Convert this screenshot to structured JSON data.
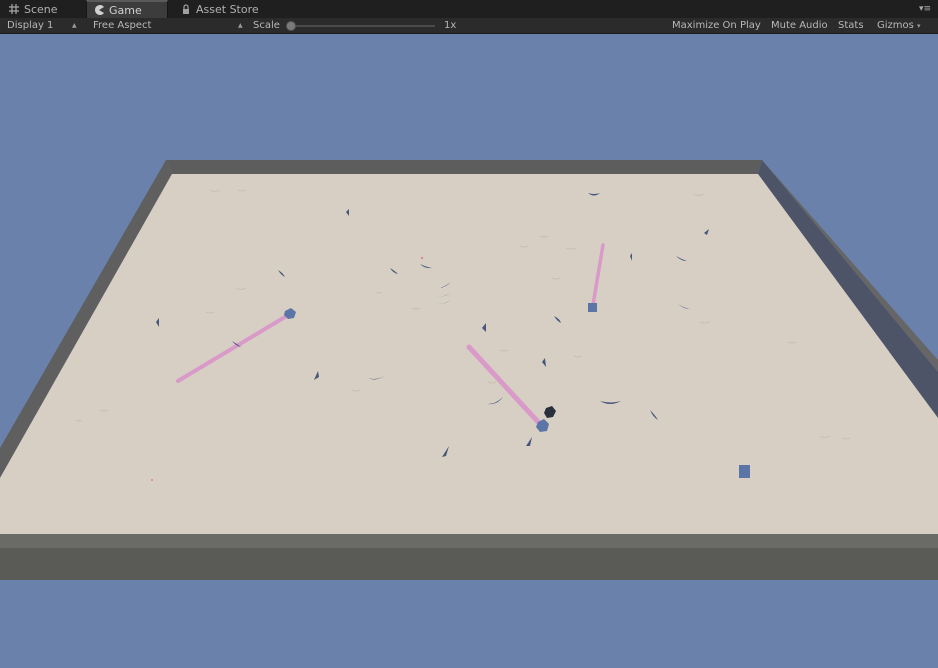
{
  "tabs": [
    {
      "label": "Scene",
      "icon": "scene-grid-icon"
    },
    {
      "label": "Game",
      "icon": "game-pacman-icon",
      "active": true
    },
    {
      "label": "Asset Store",
      "icon": "lock-icon"
    }
  ],
  "toolbar": {
    "display": "Display 1",
    "aspect": "Free Aspect",
    "scale_label": "Scale",
    "scale_value": "1x",
    "maximize_on_play": "Maximize On Play",
    "mute_audio": "Mute Audio",
    "stats": "Stats",
    "gizmos": "Gizmos"
  },
  "colors": {
    "sky": "#6a82ab",
    "floor": "#d7cfc3",
    "wall_top": "#5c5c5c",
    "wall_front": "#5a5a56",
    "laser": "#d99ac9",
    "agent": "#5b76a6",
    "food": "#46577d"
  }
}
